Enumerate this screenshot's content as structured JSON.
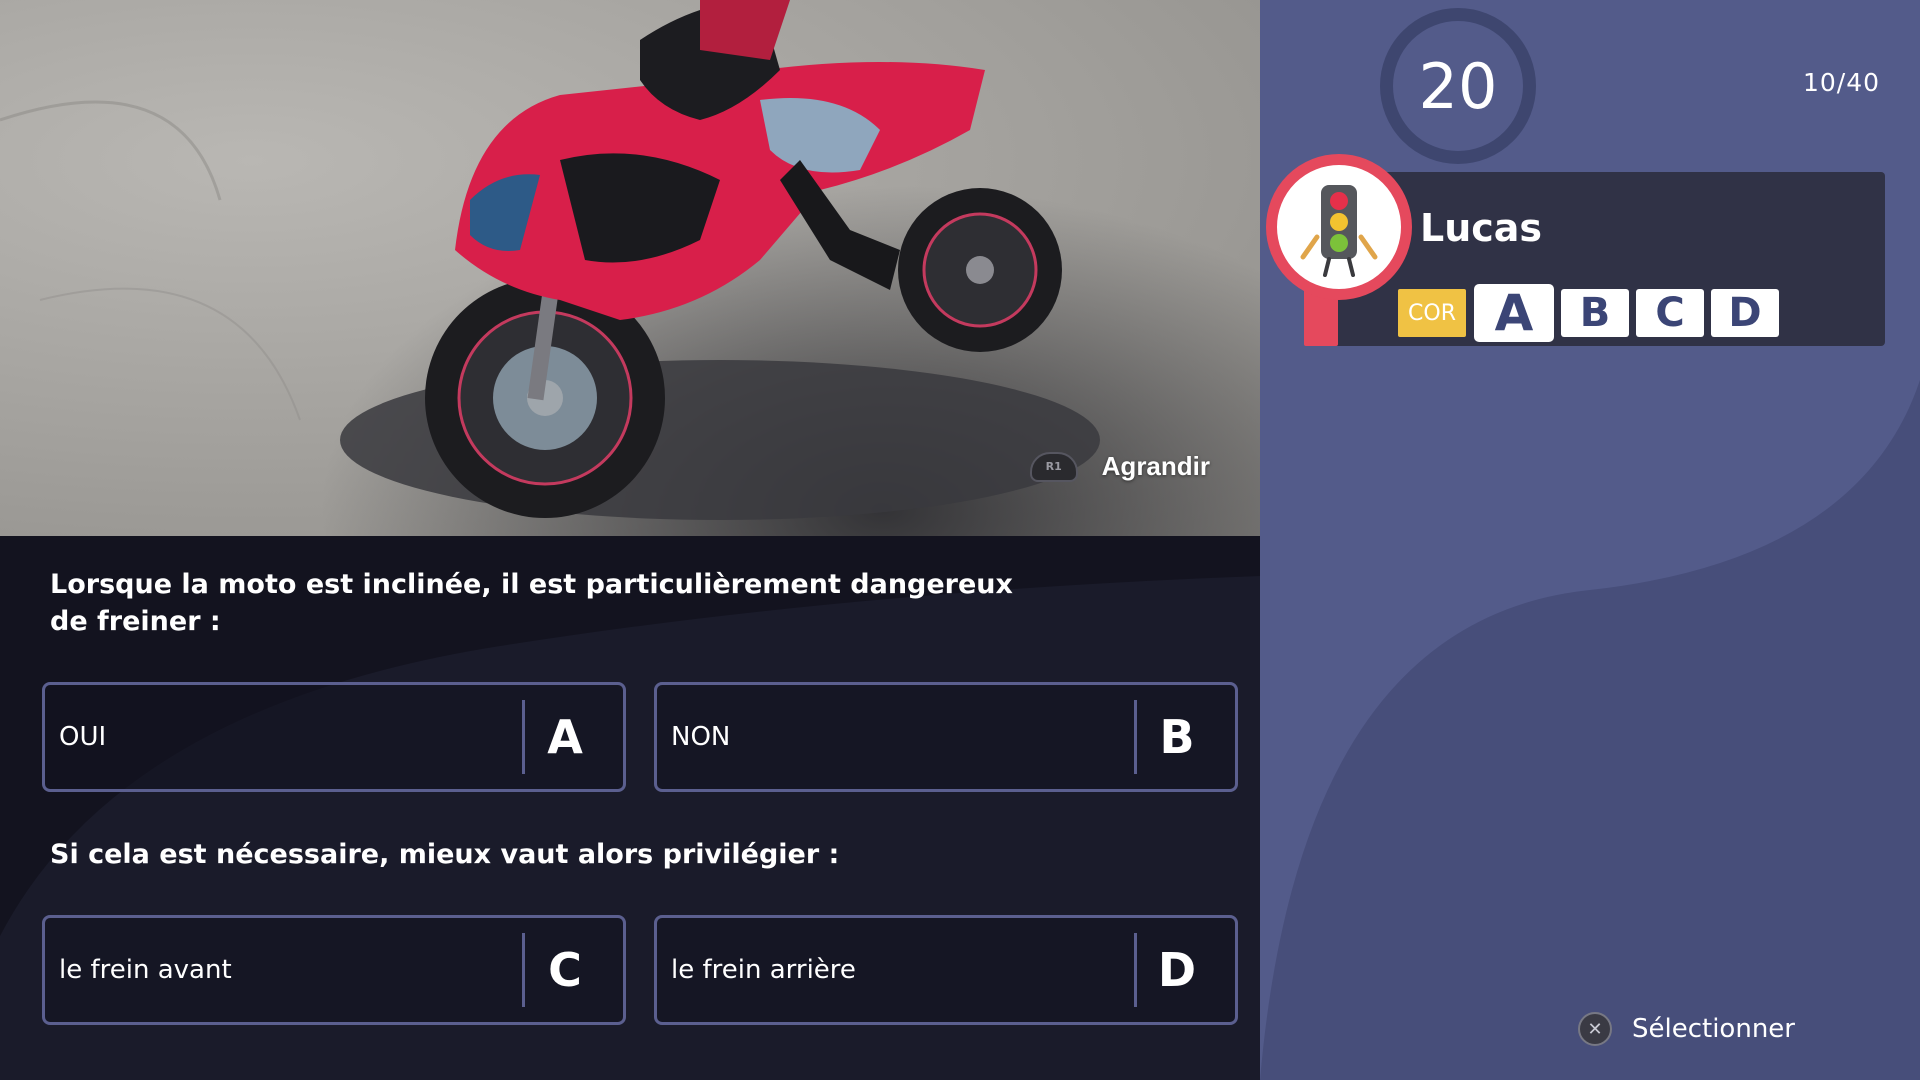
{
  "photo": {
    "zoom_button": "R1",
    "zoom_label": "Agrandir"
  },
  "question": {
    "part1": "Lorsque la moto est inclinée, il est particulièrement dangereux de freiner :",
    "part2": "Si cela est nécessaire, mieux vaut alors privilégier :",
    "answers": [
      {
        "letter": "A",
        "text": "OUI"
      },
      {
        "letter": "B",
        "text": "NON"
      },
      {
        "letter": "C",
        "text": "le frein avant"
      },
      {
        "letter": "D",
        "text": "le frein arrière"
      }
    ]
  },
  "sidebar": {
    "timer": "20",
    "progress": "10/40",
    "player": {
      "name": "Lucas",
      "avatar_icon": "traffic-light-icon",
      "tag": "COR",
      "choices": [
        "A",
        "B",
        "C",
        "D"
      ],
      "selected": "A"
    },
    "footer": {
      "button_icon": "cross-button-icon",
      "label": "Sélectionner"
    }
  },
  "colors": {
    "panel_dark": "#13131f",
    "answer_border": "#5b5f8f",
    "sidebar": "#535b8a",
    "card": "#303246",
    "accent_red": "#e5495d",
    "cor_yellow": "#f0c244"
  }
}
